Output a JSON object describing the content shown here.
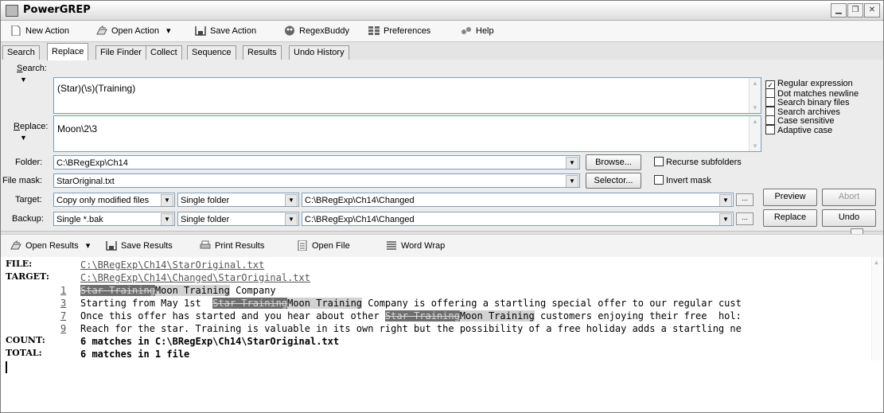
{
  "app": {
    "title": "PowerGREP"
  },
  "toolbar": {
    "new_action": "New Action",
    "open_action": "Open Action",
    "save_action": "Save Action",
    "regexbuddy": "RegexBuddy",
    "preferences": "Preferences",
    "help": "Help"
  },
  "tabs": [
    "Search",
    "Replace",
    "File Finder",
    "Collect",
    "Sequence",
    "Results",
    "Undo History"
  ],
  "active_tab": "Replace",
  "search": {
    "label": "Search:",
    "value": "(Star)(\\s)(Training)"
  },
  "replace": {
    "label": "Replace:",
    "value": "Moon\\2\\3"
  },
  "options": [
    {
      "label": "Regular expression",
      "checked": true
    },
    {
      "label": "Dot matches newline",
      "checked": false
    },
    {
      "label": "Search binary files",
      "checked": false
    },
    {
      "label": "Search archives",
      "checked": false
    },
    {
      "label": "Case sensitive",
      "checked": false
    },
    {
      "label": "Adaptive case",
      "checked": false
    }
  ],
  "folder": {
    "label": "Folder:",
    "value": "C:\\BRegExp\\Ch14",
    "browse": "Browse...",
    "recurse": "Recurse subfolders"
  },
  "filemask": {
    "label": "File mask:",
    "value": "StarOriginal.txt",
    "selector": "Selector...",
    "invert": "Invert mask"
  },
  "target": {
    "label": "Target:",
    "mode": "Copy only modified files",
    "folder_type": "Single folder",
    "path": "C:\\BRegExp\\Ch14\\Changed",
    "more": "..."
  },
  "backup": {
    "label": "Backup:",
    "mode": "Single *.bak",
    "folder_type": "Single folder",
    "path": "C:\\BRegExp\\Ch14\\Changed",
    "more": "..."
  },
  "buttons": {
    "preview": "Preview",
    "abort": "Abort",
    "replace": "Replace",
    "undo": "Undo"
  },
  "results_toolbar": {
    "open_results": "Open Results",
    "save_results": "Save Results",
    "print_results": "Print Results",
    "open_file": "Open File",
    "word_wrap": "Word Wrap"
  },
  "results": {
    "file_label": "FILE:",
    "file_path": "C:\\BRegExp\\Ch14\\StarOriginal.txt",
    "target_label": "TARGET:",
    "target_path": "C:\\BRegExp\\Ch14\\Changed\\StarOriginal.txt",
    "lines": [
      {
        "num": "1",
        "parts": [
          {
            "t": "Star Training",
            "k": "del"
          },
          {
            "t": "Moon Training",
            "k": "ins"
          },
          {
            "t": " Company",
            "k": ""
          }
        ]
      },
      {
        "num": "3",
        "parts": [
          {
            "t": "Starting from May 1st  ",
            "k": ""
          },
          {
            "t": "Star Training",
            "k": "del"
          },
          {
            "t": "Moon Training",
            "k": "ins"
          },
          {
            "t": " Company is offering a startling special offer to our regular cust",
            "k": ""
          }
        ]
      },
      {
        "num": "7",
        "parts": [
          {
            "t": "Once this offer has started and you hear about other ",
            "k": ""
          },
          {
            "t": "Star Training",
            "k": "del"
          },
          {
            "t": "Moon Training",
            "k": "ins"
          },
          {
            "t": " customers enjoying their free  hol:",
            "k": ""
          }
        ]
      },
      {
        "num": "9",
        "parts": [
          {
            "t": "Reach for the star. Training is valuable in its own right but the possibility of a free holiday adds a startling ne",
            "k": ""
          }
        ]
      }
    ],
    "count_label": "COUNT:",
    "count_text": "6 matches in C:\\BRegExp\\Ch14\\StarOriginal.txt",
    "total_label": "TOTAL:",
    "total_text": "6 matches in 1 file"
  }
}
